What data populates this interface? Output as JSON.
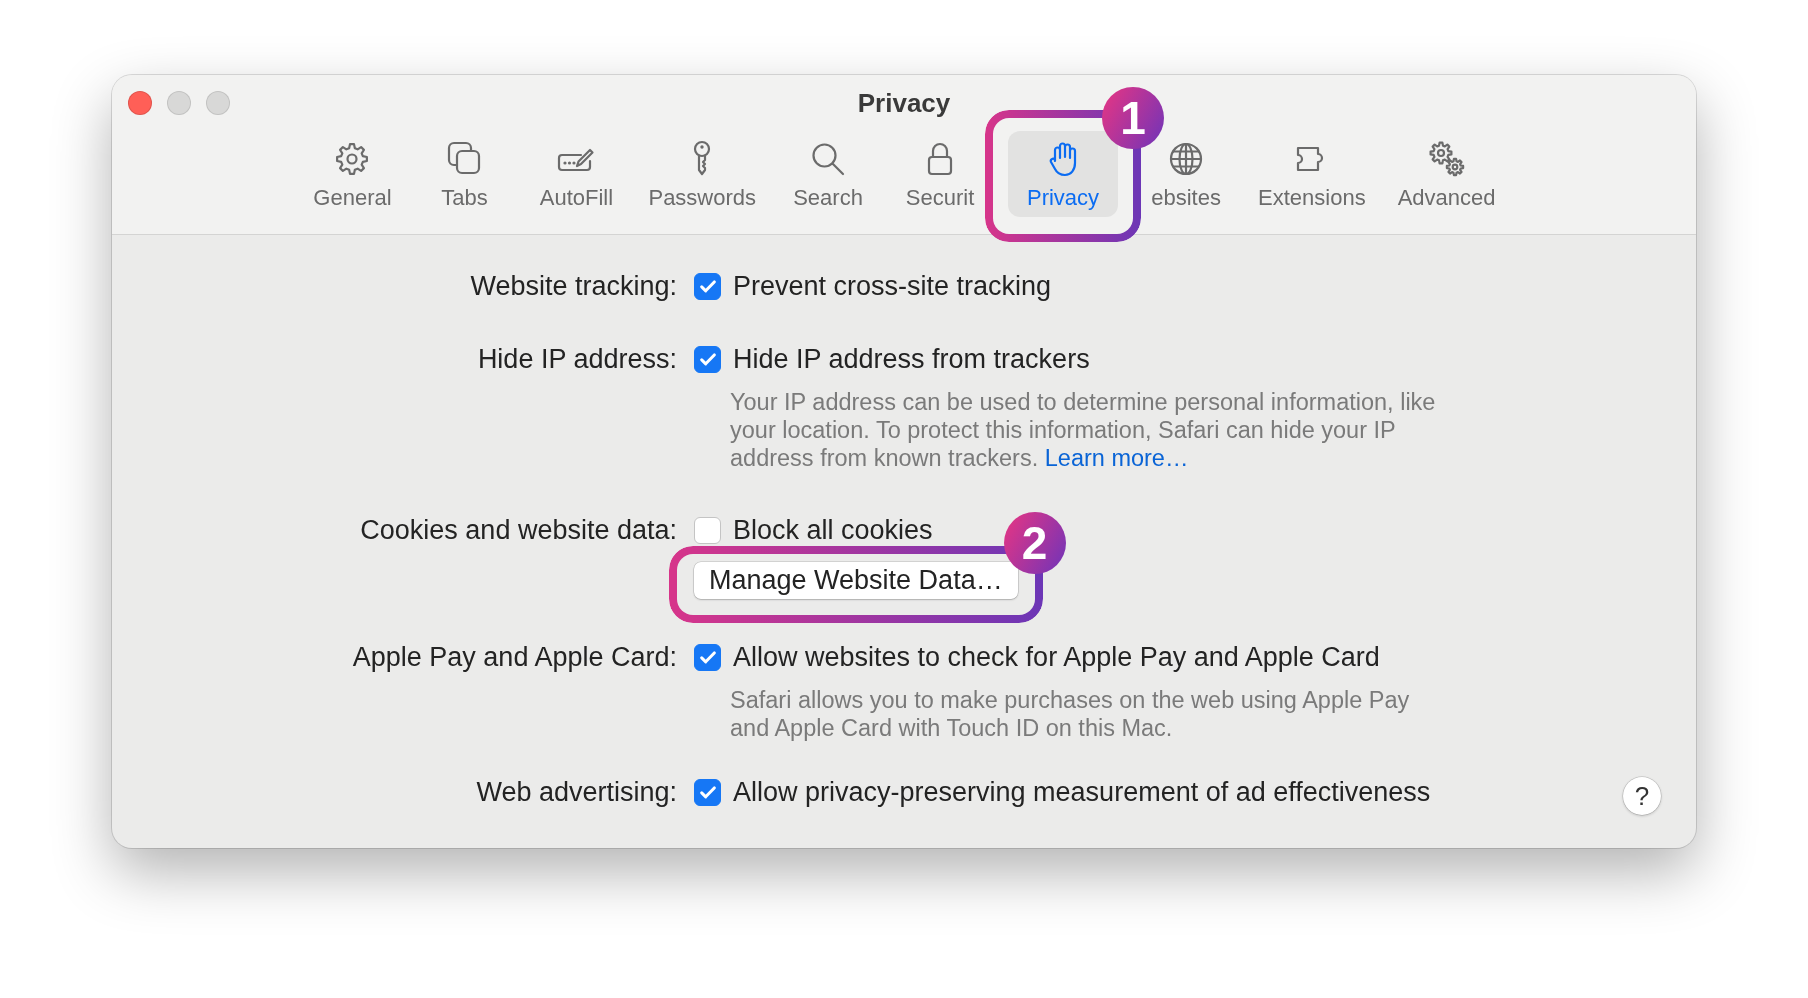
{
  "window": {
    "title": "Privacy",
    "controls": [
      {
        "kind": "close",
        "disabled": false
      },
      {
        "kind": "minimize",
        "disabled": true
      },
      {
        "kind": "zoom",
        "disabled": true
      }
    ]
  },
  "toolbar": {
    "items": [
      {
        "label": "General",
        "selected": false
      },
      {
        "label": "Tabs",
        "selected": false
      },
      {
        "label": "AutoFill",
        "selected": false
      },
      {
        "label": "Passwords",
        "selected": false
      },
      {
        "label": "Search",
        "selected": false
      },
      {
        "label": "Securit",
        "selected": false
      },
      {
        "label": "Privacy",
        "selected": true,
        "callout": "1"
      },
      {
        "label": "ebsites",
        "selected": false
      },
      {
        "label": "Extensions",
        "selected": false
      },
      {
        "label": "Advanced",
        "selected": false
      }
    ]
  },
  "settings": [
    {
      "label": "Website tracking:",
      "options": [
        {
          "kind": "checkbox",
          "text": "Prevent cross-site tracking",
          "checked": true
        }
      ]
    },
    {
      "label": "Hide IP address:",
      "options": [
        {
          "kind": "checkbox",
          "text": "Hide IP address from trackers",
          "checked": true
        }
      ],
      "description": {
        "text": "Your IP address can be used to determine personal information, like your location. To protect this information, Safari can hide your IP address from known trackers.",
        "link": "Learn more…"
      }
    },
    {
      "label": "Cookies and website data:",
      "options": [
        {
          "kind": "checkbox",
          "text": "Block all cookies",
          "checked": false
        },
        {
          "kind": "button",
          "text": "Manage Website Data…",
          "callout": "2"
        }
      ]
    },
    {
      "label": "Apple Pay and Apple Card:",
      "options": [
        {
          "kind": "checkbox",
          "text": "Allow websites to check for Apple Pay and Apple Card",
          "checked": true
        }
      ],
      "description": {
        "text": "Safari allows you to make purchases on the web using Apple Pay and Apple Card with Touch ID on this Mac."
      }
    },
    {
      "label": "Web advertising:",
      "options": [
        {
          "kind": "checkbox",
          "text": "Allow privacy-preserving measurement of ad effectiveness",
          "checked": true
        }
      ]
    }
  ],
  "help_button": {
    "label": "?"
  }
}
